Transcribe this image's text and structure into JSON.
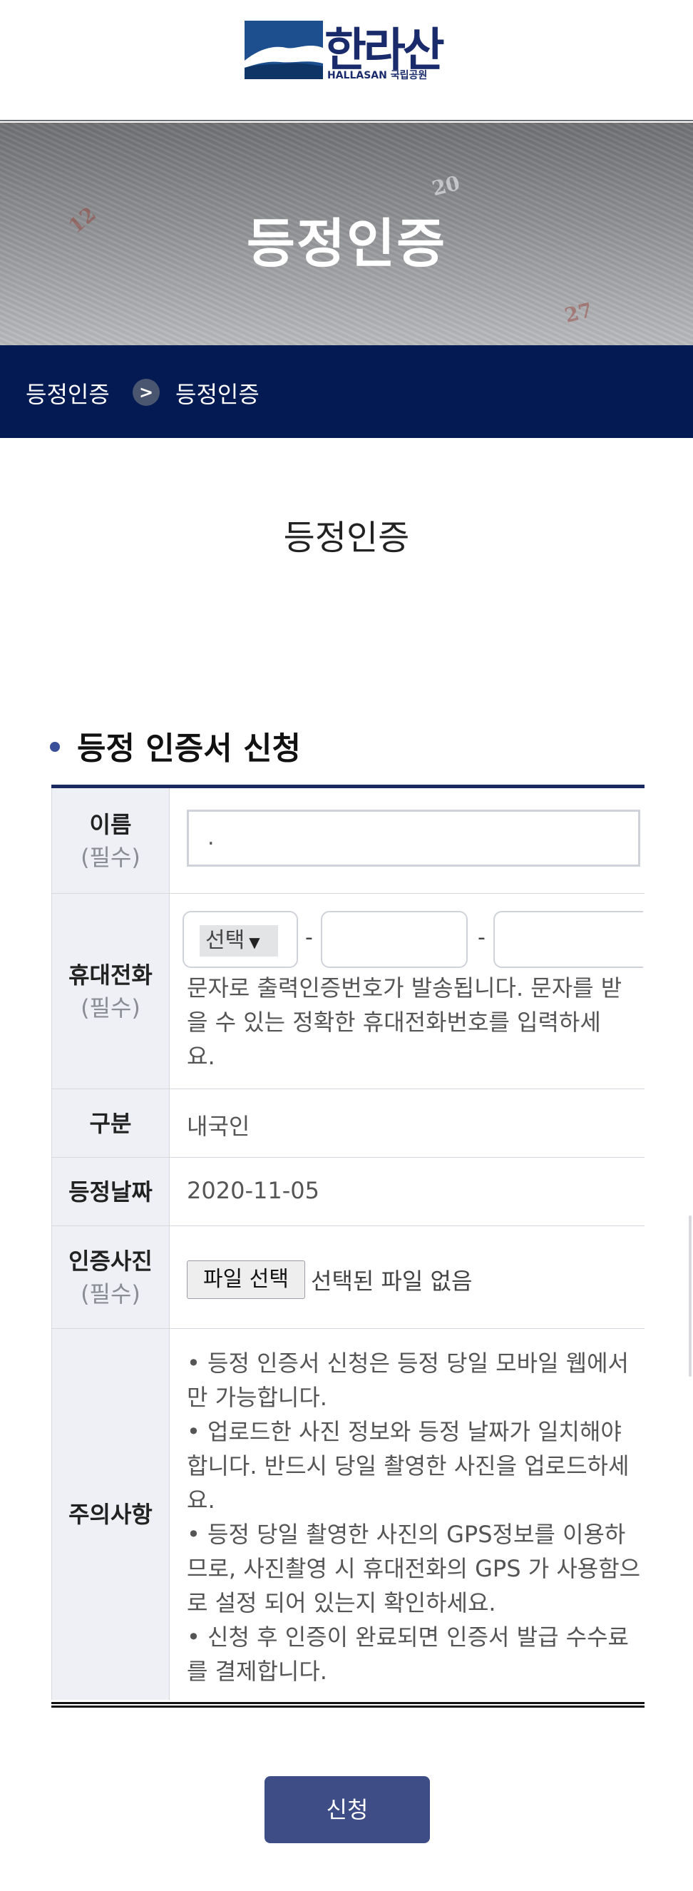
{
  "header": {
    "logo_ko": "한라산",
    "logo_en": "HALLASAN 국립공원"
  },
  "banner": {
    "title": "등정인증",
    "numbers": [
      "12",
      "20",
      "27"
    ]
  },
  "breadcrumb": {
    "items": [
      "등정인증",
      "등정인증"
    ],
    "separator": ">"
  },
  "page": {
    "title": "등정인증"
  },
  "section": {
    "title": "등정 인증서 신청"
  },
  "form": {
    "name": {
      "label": "이름",
      "required": "(필수)",
      "value": "."
    },
    "phone": {
      "label": "휴대전화",
      "required": "(필수)",
      "select_value": "선택",
      "caret": "▼",
      "dash": "-",
      "help": "문자로 출력인증번호가 발송됩니다. 문자를 받을 수 있는 정확한 휴대전화번호를 입력하세요."
    },
    "category": {
      "label": "구분",
      "value": "내국인"
    },
    "date": {
      "label": "등정날짜",
      "value": "2020-11-05"
    },
    "photo": {
      "label": "인증사진",
      "required": "(필수)",
      "button": "파일 선택",
      "status": "선택된 파일 없음"
    },
    "notice": {
      "label": "주의사항",
      "lines": [
        "• 등정 인증서 신청은 등정 당일 모바일 웹에서만 가능합니다.",
        "• 업로드한 사진 정보와 등정 날짜가 일치해야 합니다. 반드시 당일 촬영한 사진을 업로드하세요.",
        "• 등정 당일 촬영한 사진의 GPS정보를 이용하므로, 사진촬영 시 휴대전화의 GPS 가 사용함으로 설정 되어 있는지 확인하세요.",
        "• 신청 후 인증이 완료되면 인증서 발급 수수료를 결제합니다."
      ]
    }
  },
  "submit": {
    "label": "신청"
  },
  "colors": {
    "navy": "#031a52",
    "button": "#3f4d87",
    "table_border": "#1b2a5e"
  }
}
